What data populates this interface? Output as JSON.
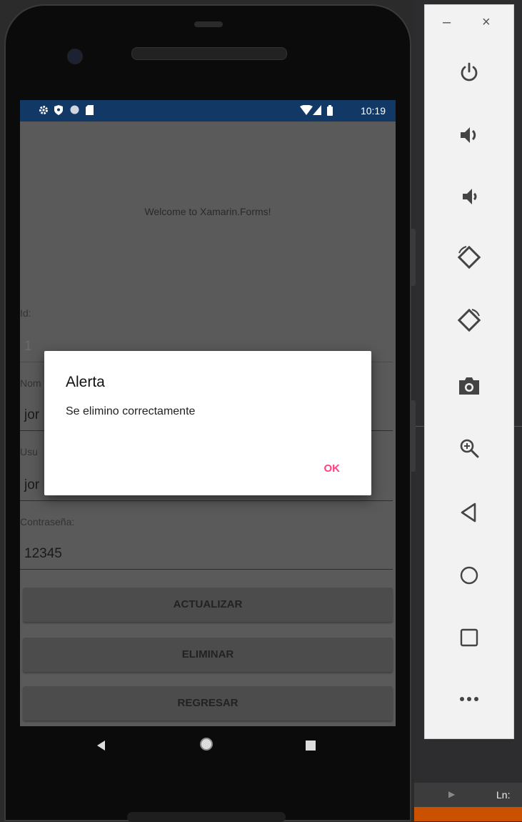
{
  "status_bar": {
    "time": "10:19",
    "left_icons": [
      "gear-icon",
      "shield-icon",
      "circle-icon",
      "sd-card-icon"
    ],
    "right_icons": [
      "wifi-icon",
      "signal-icon",
      "battery-icon"
    ]
  },
  "app": {
    "welcome": "Welcome to Xamarin.Forms!",
    "labels": {
      "id": "Id:",
      "nombre": "Nom",
      "usuario": "Usu",
      "contrasena": "Contraseña:"
    },
    "fields": {
      "id": "1",
      "nombre": "jor",
      "usuario": "jor",
      "contrasena": "12345"
    },
    "buttons": {
      "actualizar": "ACTUALIZAR",
      "eliminar": "ELIMINAR",
      "regresar": "REGRESAR"
    }
  },
  "dialog": {
    "title": "Alerta",
    "message": "Se elimino correctamente",
    "ok": "OK",
    "ok_color": "#ff4081"
  },
  "emulator_toolbar": {
    "minimize": "–",
    "close": "×",
    "icons": [
      "power-icon",
      "volume-up-icon",
      "volume-down-icon",
      "rotate-left-icon",
      "rotate-right-icon",
      "camera-icon",
      "zoom-icon",
      "back-icon",
      "home-icon",
      "overview-icon",
      "more-icon"
    ]
  },
  "ide": {
    "status": "Ln:"
  },
  "colors": {
    "status_bar": "#123866",
    "screen_dim": "#5a5a5a",
    "accent": "#ff4081"
  }
}
